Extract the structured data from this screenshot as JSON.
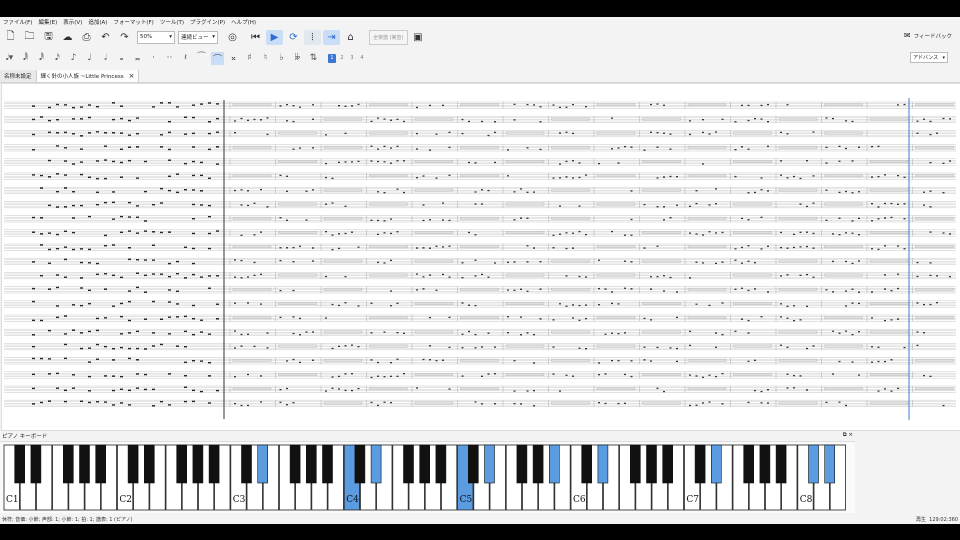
{
  "menubar": {
    "items": [
      "ファイル(F)",
      "編集(E)",
      "表示(V)",
      "追加(A)",
      "フォーマット(F)",
      "ツール(T)",
      "プラグイン(P)",
      "ヘルプ(H)"
    ]
  },
  "toolbar": {
    "icons": [
      "new-file",
      "open-folder",
      "save",
      "cloud-upload",
      "print",
      "undo",
      "redo"
    ],
    "zoom": "50%",
    "view_mode": "連続ビュー",
    "concert_pitch": "全楽譜 (実音)",
    "feedback_label": "フィードバック"
  },
  "note_input": {
    "voices": [
      "1",
      "2",
      "3",
      "4"
    ],
    "selected_voice": "1",
    "workspace": "アドバンス"
  },
  "tabs": [
    {
      "label": "名称未設定",
      "active": false
    },
    {
      "label": "輝く針の小人族 ~Little Princess",
      "active": true
    }
  ],
  "piano": {
    "title": "ピアノ キーボード",
    "octave_labels": [
      "C1",
      "C2",
      "C3",
      "C4",
      "C5",
      "C6",
      "C7",
      "C8"
    ],
    "highlighted_white": [
      21,
      28
    ],
    "highlighted_black": [
      11,
      16,
      21,
      24,
      26,
      31,
      35,
      36,
      39
    ]
  },
  "status": {
    "left": "休符; 音価: 小節; 声部: 1; 小節: 1; 拍: 1; 譜表: 1 (ピアノ)",
    "mode": "再生",
    "time": "129:02:360"
  },
  "colors": {
    "accent": "#3a78d4",
    "key_highlight": "#5b9be0"
  }
}
